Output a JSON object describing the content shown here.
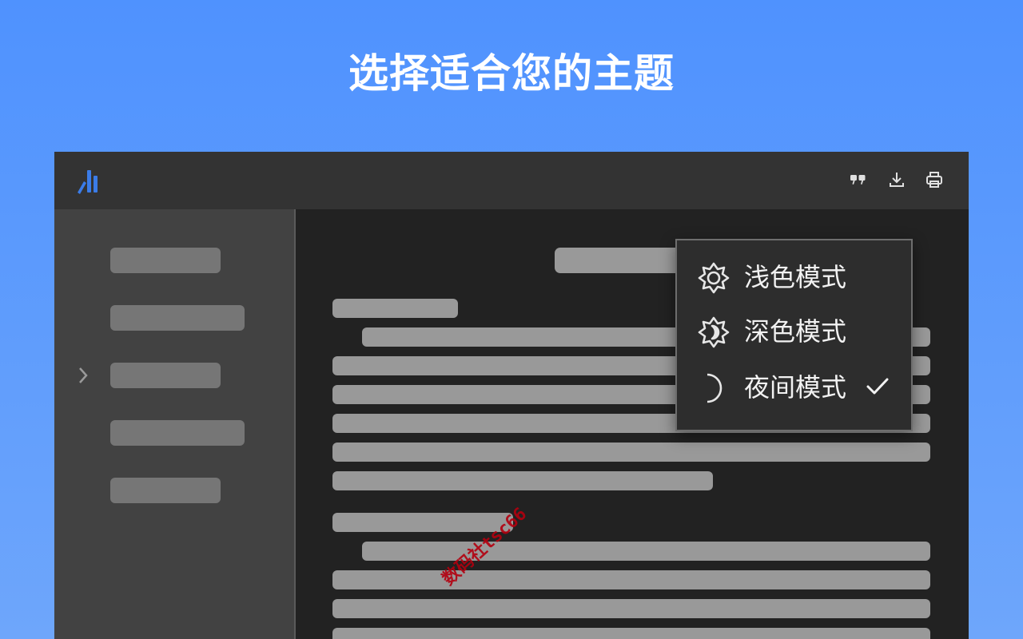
{
  "headline": "选择适合您的主题",
  "brand": {
    "accent": "#3b7ce8",
    "logo_icon": "app-logo-icon"
  },
  "toolbar": {
    "buttons": [
      {
        "name": "quote-button",
        "icon": "quote-icon"
      },
      {
        "name": "download-button",
        "icon": "download-icon"
      },
      {
        "name": "print-button",
        "icon": "print-icon"
      }
    ]
  },
  "sidebar": {
    "items": [
      "placeholder",
      "placeholder",
      "placeholder",
      "placeholder",
      "placeholder"
    ],
    "expand_icon": "chevron-right-icon"
  },
  "theme_menu": {
    "items": [
      {
        "label": "浅色模式",
        "icon": "sun-icon",
        "selected": false
      },
      {
        "label": "深色模式",
        "icon": "sun-moon-icon",
        "selected": false
      },
      {
        "label": "夜间模式",
        "icon": "moon-icon",
        "selected": true
      }
    ],
    "selected_icon": "checkmark-icon"
  },
  "watermark": "数码社tsc66",
  "colors": {
    "background_top": "#4f92fe",
    "app_bg": "#222222",
    "topbar_bg": "#333333",
    "sidebar_bg": "#424242",
    "placeholder_text": "#999999",
    "menu_bg": "#2d2d2d"
  }
}
